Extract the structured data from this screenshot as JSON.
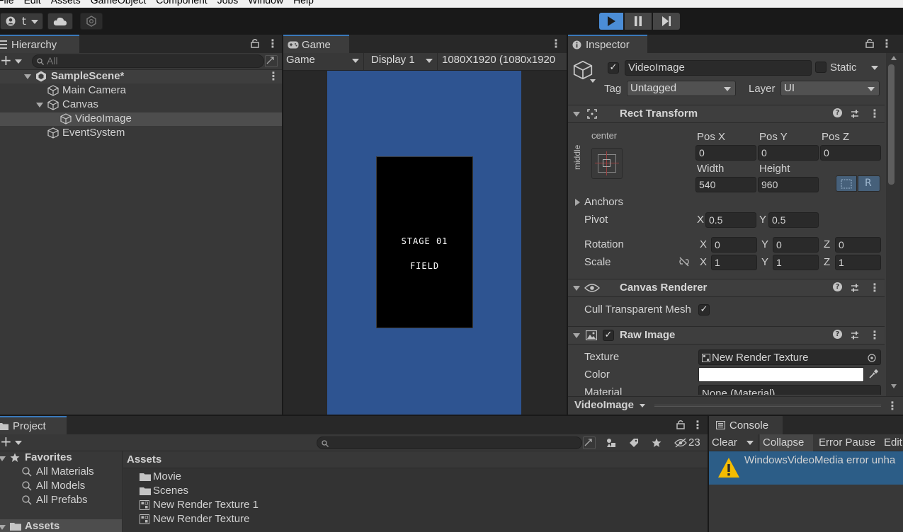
{
  "menubar": {
    "items": [
      "File",
      "Edit",
      "Assets",
      "GameObject",
      "Component",
      "Jobs",
      "Window",
      "Help"
    ]
  },
  "toolbar": {
    "account_label": "t",
    "play_state": "playing"
  },
  "hierarchy": {
    "tab_label": "Hierarchy",
    "search_placeholder": "All",
    "scene_name": "SampleScene*",
    "items": [
      {
        "label": "Main Camera"
      },
      {
        "label": "Canvas"
      },
      {
        "label": "VideoImage"
      },
      {
        "label": "EventSystem"
      }
    ]
  },
  "game": {
    "tab_label": "Game",
    "view_mode": "Game",
    "display": "Display 1",
    "resolution": "1080X1920 (1080x1920",
    "screen_text_line1": "STAGE 01",
    "screen_text_line2": "FIELD",
    "background_color": "#2e5491"
  },
  "inspector": {
    "tab_label": "Inspector",
    "object_name": "VideoImage",
    "static_label": "Static",
    "tag_label": "Tag",
    "tag_value": "Untagged",
    "layer_label": "Layer",
    "layer_value": "UI",
    "rect_transform": {
      "title": "Rect Transform",
      "anchor_h": "center",
      "anchor_v": "middle",
      "pos_x_label": "Pos X",
      "pos_y_label": "Pos Y",
      "pos_z_label": "Pos Z",
      "pos_x": "0",
      "pos_y": "0",
      "pos_z": "0",
      "width_label": "Width",
      "height_label": "Height",
      "width": "540",
      "height": "960",
      "r_label": "R",
      "anchors_label": "Anchors",
      "pivot_label": "Pivot",
      "pivot_x": "0.5",
      "pivot_y": "0.5",
      "rotation_label": "Rotation",
      "rot_x": "0",
      "rot_y": "0",
      "rot_z": "0",
      "scale_label": "Scale",
      "scale_x": "1",
      "scale_y": "1",
      "scale_z": "1",
      "x": "X",
      "y": "Y",
      "z": "Z"
    },
    "canvas_renderer": {
      "title": "Canvas Renderer",
      "cull_label": "Cull Transparent Mesh"
    },
    "raw_image": {
      "title": "Raw Image",
      "texture_label": "Texture",
      "texture_value": "New Render Texture",
      "color_label": "Color",
      "material_label": "Material",
      "material_value": "None (Material)"
    },
    "footer_label": "VideoImage"
  },
  "project": {
    "tab_label": "Project",
    "hidden_count": "23",
    "favorites_label": "Favorites",
    "favorites": [
      "All Materials",
      "All Models",
      "All Prefabs"
    ],
    "assets_root_label": "Assets",
    "breadcrumb": "Assets",
    "assets": [
      {
        "label": "Movie",
        "icon": "folder-icon"
      },
      {
        "label": "Scenes",
        "icon": "folder-icon"
      },
      {
        "label": "New Render Texture 1",
        "icon": "render-texture-icon"
      },
      {
        "label": "New Render Texture",
        "icon": "render-texture-icon"
      }
    ]
  },
  "console": {
    "tab_label": "Console",
    "clear_label": "Clear",
    "collapse_label": "Collapse",
    "error_pause_label": "Error Pause",
    "editor_label": "Edit",
    "message": "WindowsVideoMedia error unha"
  },
  "colors": {
    "accent": "#3a79bb",
    "play_active": "#4b8dd6",
    "selected_row": "#4d4d4d",
    "console_selected": "#2c5d87"
  }
}
